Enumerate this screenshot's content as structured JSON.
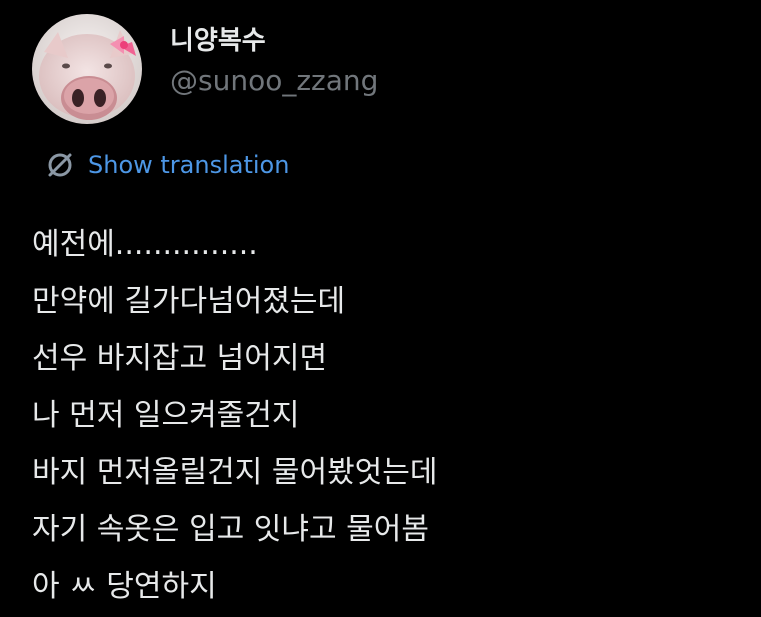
{
  "tweet": {
    "author": {
      "display_name": "니양복수",
      "handle": "@sunoo_zzang",
      "avatar_icon": "pig-with-pink-bow-avatar"
    },
    "translate": {
      "label": "Show translation",
      "icon": "globe-translate-icon",
      "color": "#4d97e6"
    },
    "lines": [
      "예전에...............",
      "만약에 길가다넘어졌는데",
      "선우 바지잡고 넘어지면",
      "나 먼저 일으켜줄건지",
      "바지 먼저올릴건지 물어봤엇는데",
      "자기 속옷은 입고 잇냐고 물어봄",
      "아 ㅆ 당연하지"
    ]
  },
  "colors": {
    "background": "#000000",
    "text_primary": "#e7e9ea",
    "text_secondary": "#71767b",
    "link": "#4d97e6"
  }
}
